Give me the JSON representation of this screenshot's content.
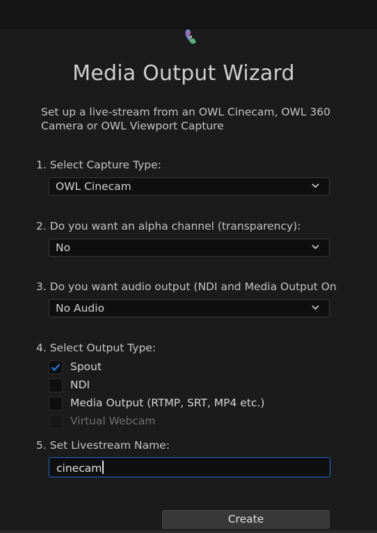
{
  "wizard": {
    "title": "Media Output Wizard",
    "intro": "Set up a live-stream from an OWL Cinecam, OWL 360 Camera or OWL Viewport Capture"
  },
  "steps": {
    "capture_type": {
      "label": "1. Select Capture Type:",
      "selected": "OWL Cinecam"
    },
    "alpha": {
      "label": "2. Do you want an alpha channel (transparency):",
      "selected": "No"
    },
    "audio": {
      "label": "3. Do you want audio output (NDI and Media Output On",
      "selected": "No Audio"
    },
    "output_type": {
      "label": "4. Select Output Type:",
      "options": [
        {
          "label": "Spout",
          "checked": true,
          "enabled": true
        },
        {
          "label": "NDI",
          "checked": false,
          "enabled": true
        },
        {
          "label": "Media Output (RTMP, SRT, MP4 etc.)",
          "checked": false,
          "enabled": true
        },
        {
          "label": "Virtual Webcam",
          "checked": false,
          "enabled": false
        }
      ]
    },
    "livestream_name": {
      "label": "5. Set Livestream Name:",
      "value": "cinecam"
    }
  },
  "actions": {
    "create_label": "Create"
  },
  "colors": {
    "background": "#1b1b1b",
    "focus_border": "#1f6fd1",
    "check_accent": "#2a7de1"
  },
  "icons": {
    "logo": "owl-logo-icon",
    "dropdown": "chevron-down-icon",
    "check": "checkmark-icon"
  }
}
